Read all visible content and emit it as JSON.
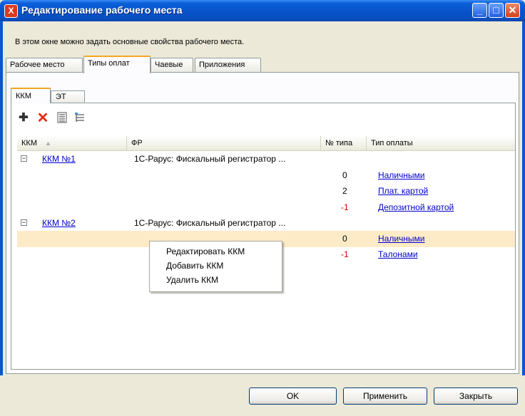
{
  "window": {
    "title": "Редактирование рабочего места"
  },
  "hint": "В этом окне можно задать основные свойства рабочего места.",
  "outer_tabs": [
    "Рабочее место",
    "Типы оплат",
    "Чаевые",
    "Приложения"
  ],
  "inner_tabs": [
    "ККМ",
    "ЭТ"
  ],
  "grid": {
    "headers": [
      "ККМ",
      "ФР",
      "№ типа",
      "Тип оплаты"
    ],
    "rows": [
      {
        "kkm": "ККМ №1",
        "fr": "1С-Рарус: Фискальный регистратор ..."
      },
      {
        "num": "0",
        "type": "Наличными"
      },
      {
        "num": "2",
        "type": "Плат. картой"
      },
      {
        "num": "-1",
        "type": "Депозитной картой"
      },
      {
        "kkm": "ККМ №2",
        "fr": "1С-Рарус: Фискальный регистратор ..."
      },
      {
        "num": "0",
        "type": "Наличными"
      },
      {
        "num": "-1",
        "type": "Талонами"
      }
    ]
  },
  "context_menu": [
    "Редактировать ККМ",
    "Добавить ККМ",
    "Удалить ККМ"
  ],
  "buttons": {
    "ok": "OK",
    "apply": "Применить",
    "close": "Закрыть"
  }
}
